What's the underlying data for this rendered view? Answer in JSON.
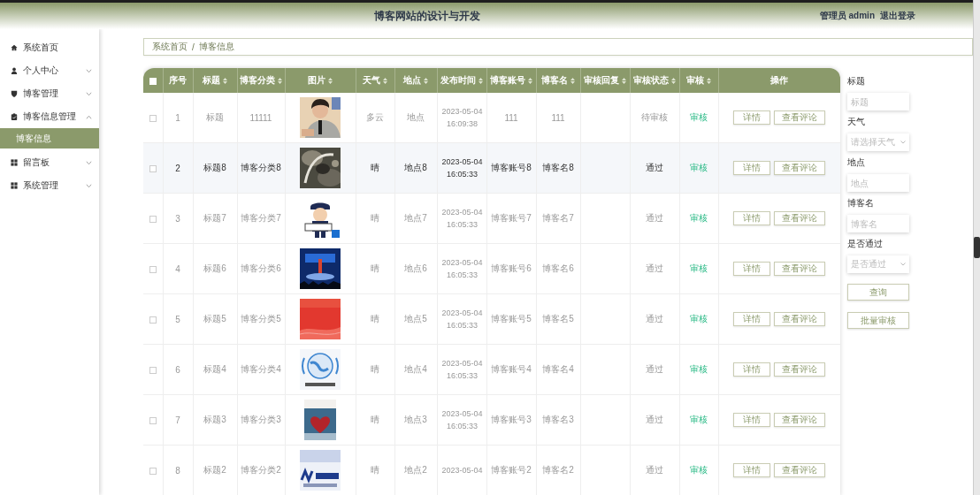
{
  "header": {
    "title": "博客网站的设计与开发",
    "user": "管理员 admin",
    "logout": "退出登录"
  },
  "sidebar": {
    "items": [
      {
        "label": "系统首页",
        "kind": "link"
      },
      {
        "label": "个人中心",
        "kind": "menu",
        "expanded": false
      },
      {
        "label": "博客管理",
        "kind": "menu",
        "expanded": false
      },
      {
        "label": "博客信息管理",
        "kind": "menu",
        "expanded": true,
        "children": [
          {
            "label": "博客信息",
            "selected": true
          }
        ]
      },
      {
        "label": "留言板",
        "kind": "menu",
        "expanded": false
      },
      {
        "label": "系统管理",
        "kind": "menu",
        "expanded": false
      }
    ]
  },
  "breadcrumb": [
    "系统首页",
    "/",
    "博客信息"
  ],
  "table": {
    "select_all": {
      "checked": false
    },
    "columns": [
      {
        "label": "序号",
        "sortable": false
      },
      {
        "label": "标题",
        "sortable": true
      },
      {
        "label": "博客分类",
        "sortable": true
      },
      {
        "label": "图片",
        "sortable": true
      },
      {
        "label": "天气",
        "sortable": true
      },
      {
        "label": "地点",
        "sortable": true
      },
      {
        "label": "发布时间",
        "sortable": true
      },
      {
        "label": "博客账号",
        "sortable": true
      },
      {
        "label": "博客名",
        "sortable": true
      },
      {
        "label": "审核回复",
        "sortable": true
      },
      {
        "label": "审核状态",
        "sortable": true
      },
      {
        "label": "审核",
        "sortable": true
      },
      {
        "label": "操作",
        "sortable": false
      }
    ],
    "rows": [
      {
        "index": "1",
        "checked": false,
        "highlighted": false,
        "title": "标题",
        "category": "11111",
        "picture": {
          "kind": "picture"
        },
        "weather": "多云",
        "location": "地点",
        "published": "2023-05-04 16:09:38",
        "account": "111",
        "blogger": "111",
        "review_status": "待审核",
        "audit": "审核",
        "actions": [
          "详情",
          "查看评论"
        ]
      },
      {
        "index": "2",
        "checked": false,
        "highlighted": true,
        "title": "标题8",
        "category": "博客分类8",
        "picture": {
          "kind": "picture"
        },
        "weather": "晴",
        "location": "地点8",
        "published": "2023-05-04 16:05:33",
        "account": "博客账号8",
        "blogger": "博客名8",
        "review_status": "通过",
        "audit": "审核",
        "actions": [
          "详情",
          "查看评论"
        ]
      },
      {
        "index": "3",
        "checked": false,
        "highlighted": false,
        "title": "标题7",
        "category": "博客分类7",
        "picture": {
          "kind": "picture"
        },
        "weather": "晴",
        "location": "地点7",
        "published": "2023-05-04 16:05:33",
        "account": "博客账号7",
        "blogger": "博客名7",
        "review_status": "通过",
        "audit": "审核",
        "actions": [
          "详情",
          "查看评论"
        ]
      },
      {
        "index": "4",
        "checked": false,
        "highlighted": false,
        "title": "标题6",
        "category": "博客分类6",
        "picture": {
          "kind": "picture"
        },
        "weather": "晴",
        "location": "地点6",
        "published": "2023-05-04 16:05:33",
        "account": "博客账号6",
        "blogger": "博客名6",
        "review_status": "通过",
        "audit": "审核",
        "actions": [
          "详情",
          "查看评论"
        ]
      },
      {
        "index": "5",
        "checked": false,
        "highlighted": false,
        "title": "标题5",
        "category": "博客分类5",
        "picture": {
          "kind": "picture"
        },
        "weather": "晴",
        "location": "地点5",
        "published": "2023-05-04 16:05:33",
        "account": "博客账号5",
        "blogger": "博客名5",
        "review_status": "通过",
        "audit": "审核",
        "actions": [
          "详情",
          "查看评论"
        ]
      },
      {
        "index": "6",
        "checked": false,
        "highlighted": false,
        "title": "标题4",
        "category": "博客分类4",
        "picture": {
          "kind": "picture"
        },
        "weather": "晴",
        "location": "地点4",
        "published": "2023-05-04 16:05:33",
        "account": "博客账号4",
        "blogger": "博客名4",
        "review_status": "通过",
        "audit": "审核",
        "actions": [
          "详情",
          "查看评论"
        ]
      },
      {
        "index": "7",
        "checked": false,
        "highlighted": false,
        "title": "标题3",
        "category": "博客分类3",
        "picture": {
          "kind": "picture"
        },
        "weather": "晴",
        "location": "地点3",
        "published": "2023-05-04 16:05:33",
        "account": "博客账号3",
        "blogger": "博客名3",
        "review_status": "通过",
        "audit": "审核",
        "actions": [
          "详情",
          "查看评论"
        ]
      },
      {
        "index": "8",
        "checked": false,
        "highlighted": false,
        "title": "标题2",
        "category": "博客分类2",
        "picture": {
          "kind": "picture"
        },
        "weather": "晴",
        "location": "地点2",
        "published": "2023-05-04",
        "account": "博客账号2",
        "blogger": "博客名2",
        "review_status": "通过",
        "audit": "审核",
        "actions": [
          "详情",
          "查看评论"
        ]
      }
    ]
  },
  "filters": {
    "fields": [
      {
        "label": "标题",
        "kind": "input",
        "placeholder": "标题"
      },
      {
        "label": "天气",
        "kind": "select",
        "placeholder": "请选择天气"
      },
      {
        "label": "地点",
        "kind": "input",
        "placeholder": "地点"
      },
      {
        "label": "博客名",
        "kind": "input",
        "placeholder": "博客名"
      },
      {
        "label": "是否通过",
        "kind": "select",
        "placeholder": "是否通过"
      }
    ],
    "buttons": [
      "查询",
      "批量审核"
    ]
  }
}
